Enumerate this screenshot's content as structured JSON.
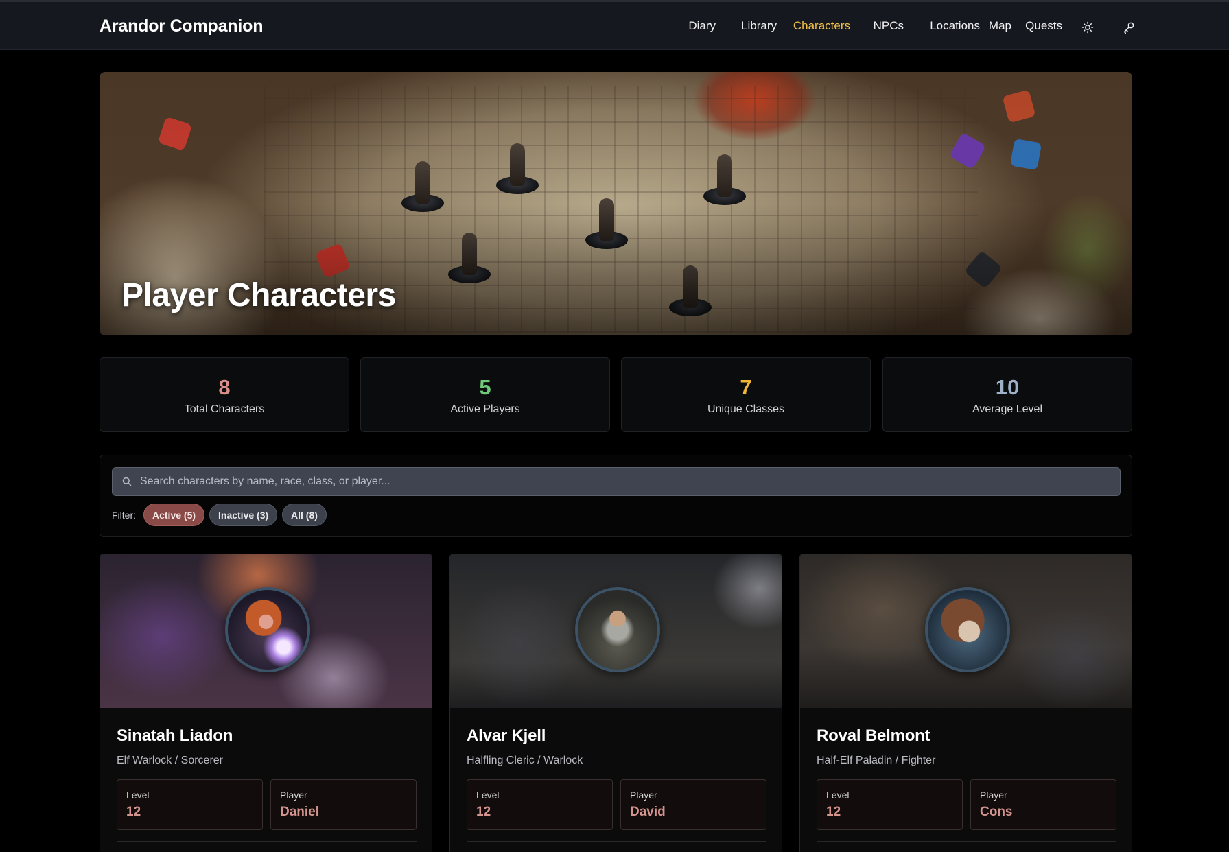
{
  "app": {
    "title": "Arandor Companion"
  },
  "nav": {
    "items": [
      {
        "label": "Diary",
        "active": false
      },
      {
        "label": "Library",
        "active": false
      },
      {
        "label": "Characters",
        "active": true
      },
      {
        "label": "NPCs",
        "active": false
      },
      {
        "label": "Locations",
        "active": false
      },
      {
        "label": "Map",
        "active": false
      },
      {
        "label": "Quests",
        "active": false
      }
    ],
    "theme_icon": "sun-icon",
    "login_icon": "key-icon",
    "active_color": "#f2c14a"
  },
  "hero": {
    "title": "Player Characters"
  },
  "stats": [
    {
      "value": "8",
      "label": "Total Characters",
      "color": "#d99089"
    },
    {
      "value": "5",
      "label": "Active Players",
      "color": "#6fc978"
    },
    {
      "value": "7",
      "label": "Unique Classes",
      "color": "#f0b637"
    },
    {
      "value": "10",
      "label": "Average Level",
      "color": "#9eb0c8"
    }
  ],
  "search": {
    "placeholder": "Search characters by name, race, class, or player...",
    "value": "",
    "icon": "search-icon"
  },
  "filter": {
    "label": "Filter:",
    "options": [
      {
        "label": "Active (5)",
        "selected": true
      },
      {
        "label": "Inactive (3)",
        "selected": false
      },
      {
        "label": "All (8)",
        "selected": false
      }
    ],
    "selected_color": "#8a4b48"
  },
  "characters": [
    {
      "name": "Sinatah Liadon",
      "subtitle": "Elf Warlock / Sorcerer",
      "level_label": "Level",
      "level": "12",
      "player_label": "Player",
      "player": "Daniel"
    },
    {
      "name": "Alvar Kjell",
      "subtitle": "Halfling Cleric / Warlock",
      "level_label": "Level",
      "level": "12",
      "player_label": "Player",
      "player": "David"
    },
    {
      "name": "Roval Belmont",
      "subtitle": "Half-Elf Paladin / Fighter",
      "level_label": "Level",
      "level": "12",
      "player_label": "Player",
      "player": "Cons"
    }
  ]
}
